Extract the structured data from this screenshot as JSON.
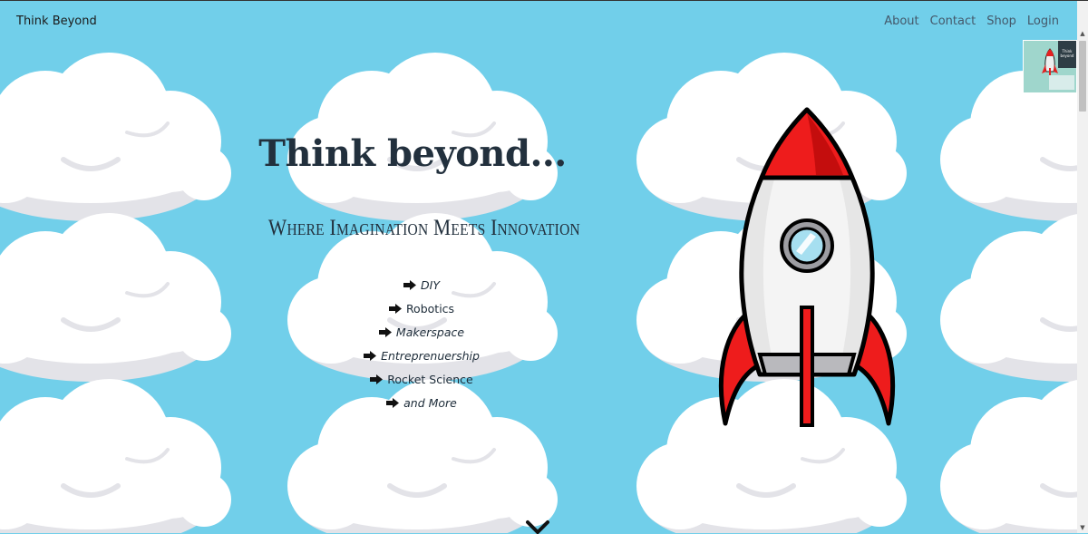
{
  "navbar": {
    "brand": "Think Beyond",
    "links": [
      {
        "label": "About"
      },
      {
        "label": "Contact"
      },
      {
        "label": "Shop"
      },
      {
        "label": "Login"
      }
    ]
  },
  "thumbnail": {
    "text": "Think beyond"
  },
  "hero": {
    "title": "Think beyond...",
    "subtitle": "Where Imagination Meets Innovation",
    "topics": [
      {
        "label": "DIY",
        "style": "italic"
      },
      {
        "label": "Robotics",
        "style": "normal"
      },
      {
        "label": "Makerspace",
        "style": "italic"
      },
      {
        "label": "Entreprenuership",
        "style": "italic"
      },
      {
        "label": "Rocket Science",
        "style": "normal"
      },
      {
        "label": "and More",
        "style": "italic"
      }
    ],
    "scroll_icon": "chevron-down-icon"
  },
  "colors": {
    "sky": "#71cfea",
    "cloud": "#ffffff",
    "cloud_shade": "#e3e3e8",
    "rocket_red": "#ee1c1c",
    "rocket_body": "#e6e6e6",
    "text_dark": "#22303d"
  }
}
